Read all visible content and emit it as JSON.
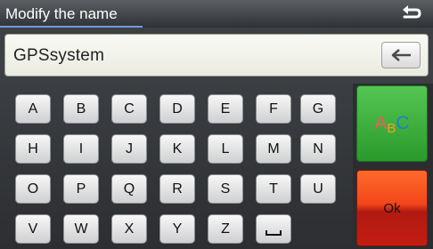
{
  "header": {
    "title": "Modify the name",
    "back_icon": "return-arrow-icon"
  },
  "input": {
    "value": "GPSsystem",
    "backspace_icon": "backspace-arrow-icon"
  },
  "keyboard": {
    "rows": [
      [
        "A",
        "B",
        "C",
        "D",
        "E",
        "F",
        "G"
      ],
      [
        "H",
        "I",
        "J",
        "K",
        "L",
        "M",
        "N"
      ],
      [
        "O",
        "P",
        "Q",
        "R",
        "S",
        "T",
        "U"
      ],
      [
        "V",
        "W",
        "X",
        "Y",
        "Z"
      ]
    ],
    "space_icon": "space-bar-icon"
  },
  "side": {
    "abc": {
      "a": "A",
      "b": "B",
      "c": "C"
    },
    "ok_label": "Ok"
  },
  "colors": {
    "abc_a": "#f05a5a",
    "abc_b": "#f0a020",
    "abc_c": "#1f7fd0",
    "accent_green": "#3fb141",
    "accent_red": "#e0391a",
    "title_underline": "#6e9fd6"
  }
}
